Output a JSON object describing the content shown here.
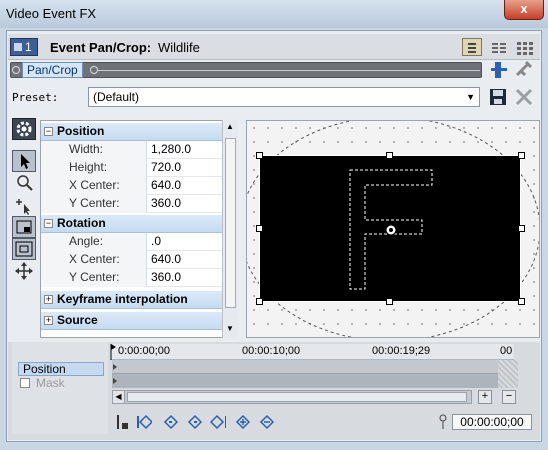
{
  "window": {
    "title": "Video Event FX",
    "close_glyph": "x"
  },
  "header": {
    "chain_index": "1",
    "fx_title": "Event Pan/Crop:",
    "fx_name": "Wildlife"
  },
  "track": {
    "label": "Pan/Crop"
  },
  "preset": {
    "label": "Preset:",
    "value": "(Default)"
  },
  "sections": {
    "position": {
      "title": "Position",
      "rows": [
        {
          "key": "Width:",
          "value": "1,280.0"
        },
        {
          "key": "Height:",
          "value": "720.0"
        },
        {
          "key": "X Center:",
          "value": "640.0"
        },
        {
          "key": "Y Center:",
          "value": "360.0"
        }
      ]
    },
    "rotation": {
      "title": "Rotation",
      "rows": [
        {
          "key": "Angle:",
          "value": ".0"
        },
        {
          "key": "X Center:",
          "value": "640.0"
        },
        {
          "key": "Y Center:",
          "value": "360.0"
        }
      ]
    },
    "keyframe": {
      "title": "Keyframe interpolation"
    },
    "source": {
      "title": "Source"
    }
  },
  "preview": {
    "letter": "F"
  },
  "timeline": {
    "tracks": {
      "position": "Position",
      "mask": "Mask"
    },
    "ruler": [
      "0:00:00;00",
      "00:00:10;00",
      "00:00:19;29",
      "00"
    ],
    "current_time": "00:00:00;00",
    "zoom_in": "+",
    "zoom_out": "−"
  }
}
